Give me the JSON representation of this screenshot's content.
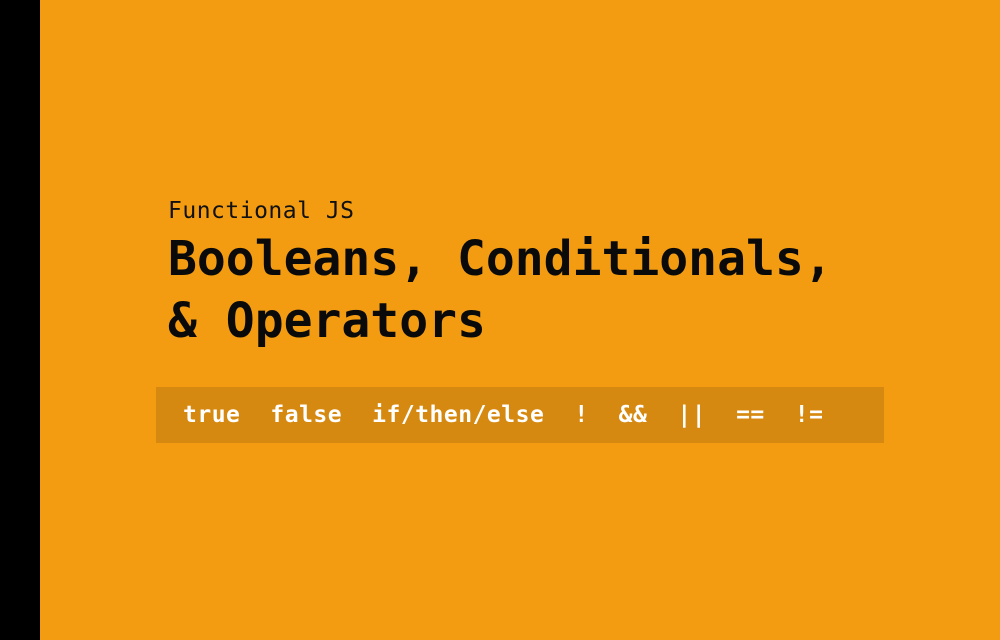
{
  "subtitle": "Functional JS",
  "title": {
    "line1": "Booleans, Conditionals,",
    "line2": "& Operators"
  },
  "keywords": [
    "true",
    "false",
    "if/then/else",
    "!",
    "&&",
    "||",
    "==",
    "!="
  ],
  "colors": {
    "background": "#f39c12",
    "left_bar": "#000000",
    "keywords_bar": "#d68910",
    "keyword_text": "#ffffff",
    "title_text": "#0a0a0a"
  }
}
